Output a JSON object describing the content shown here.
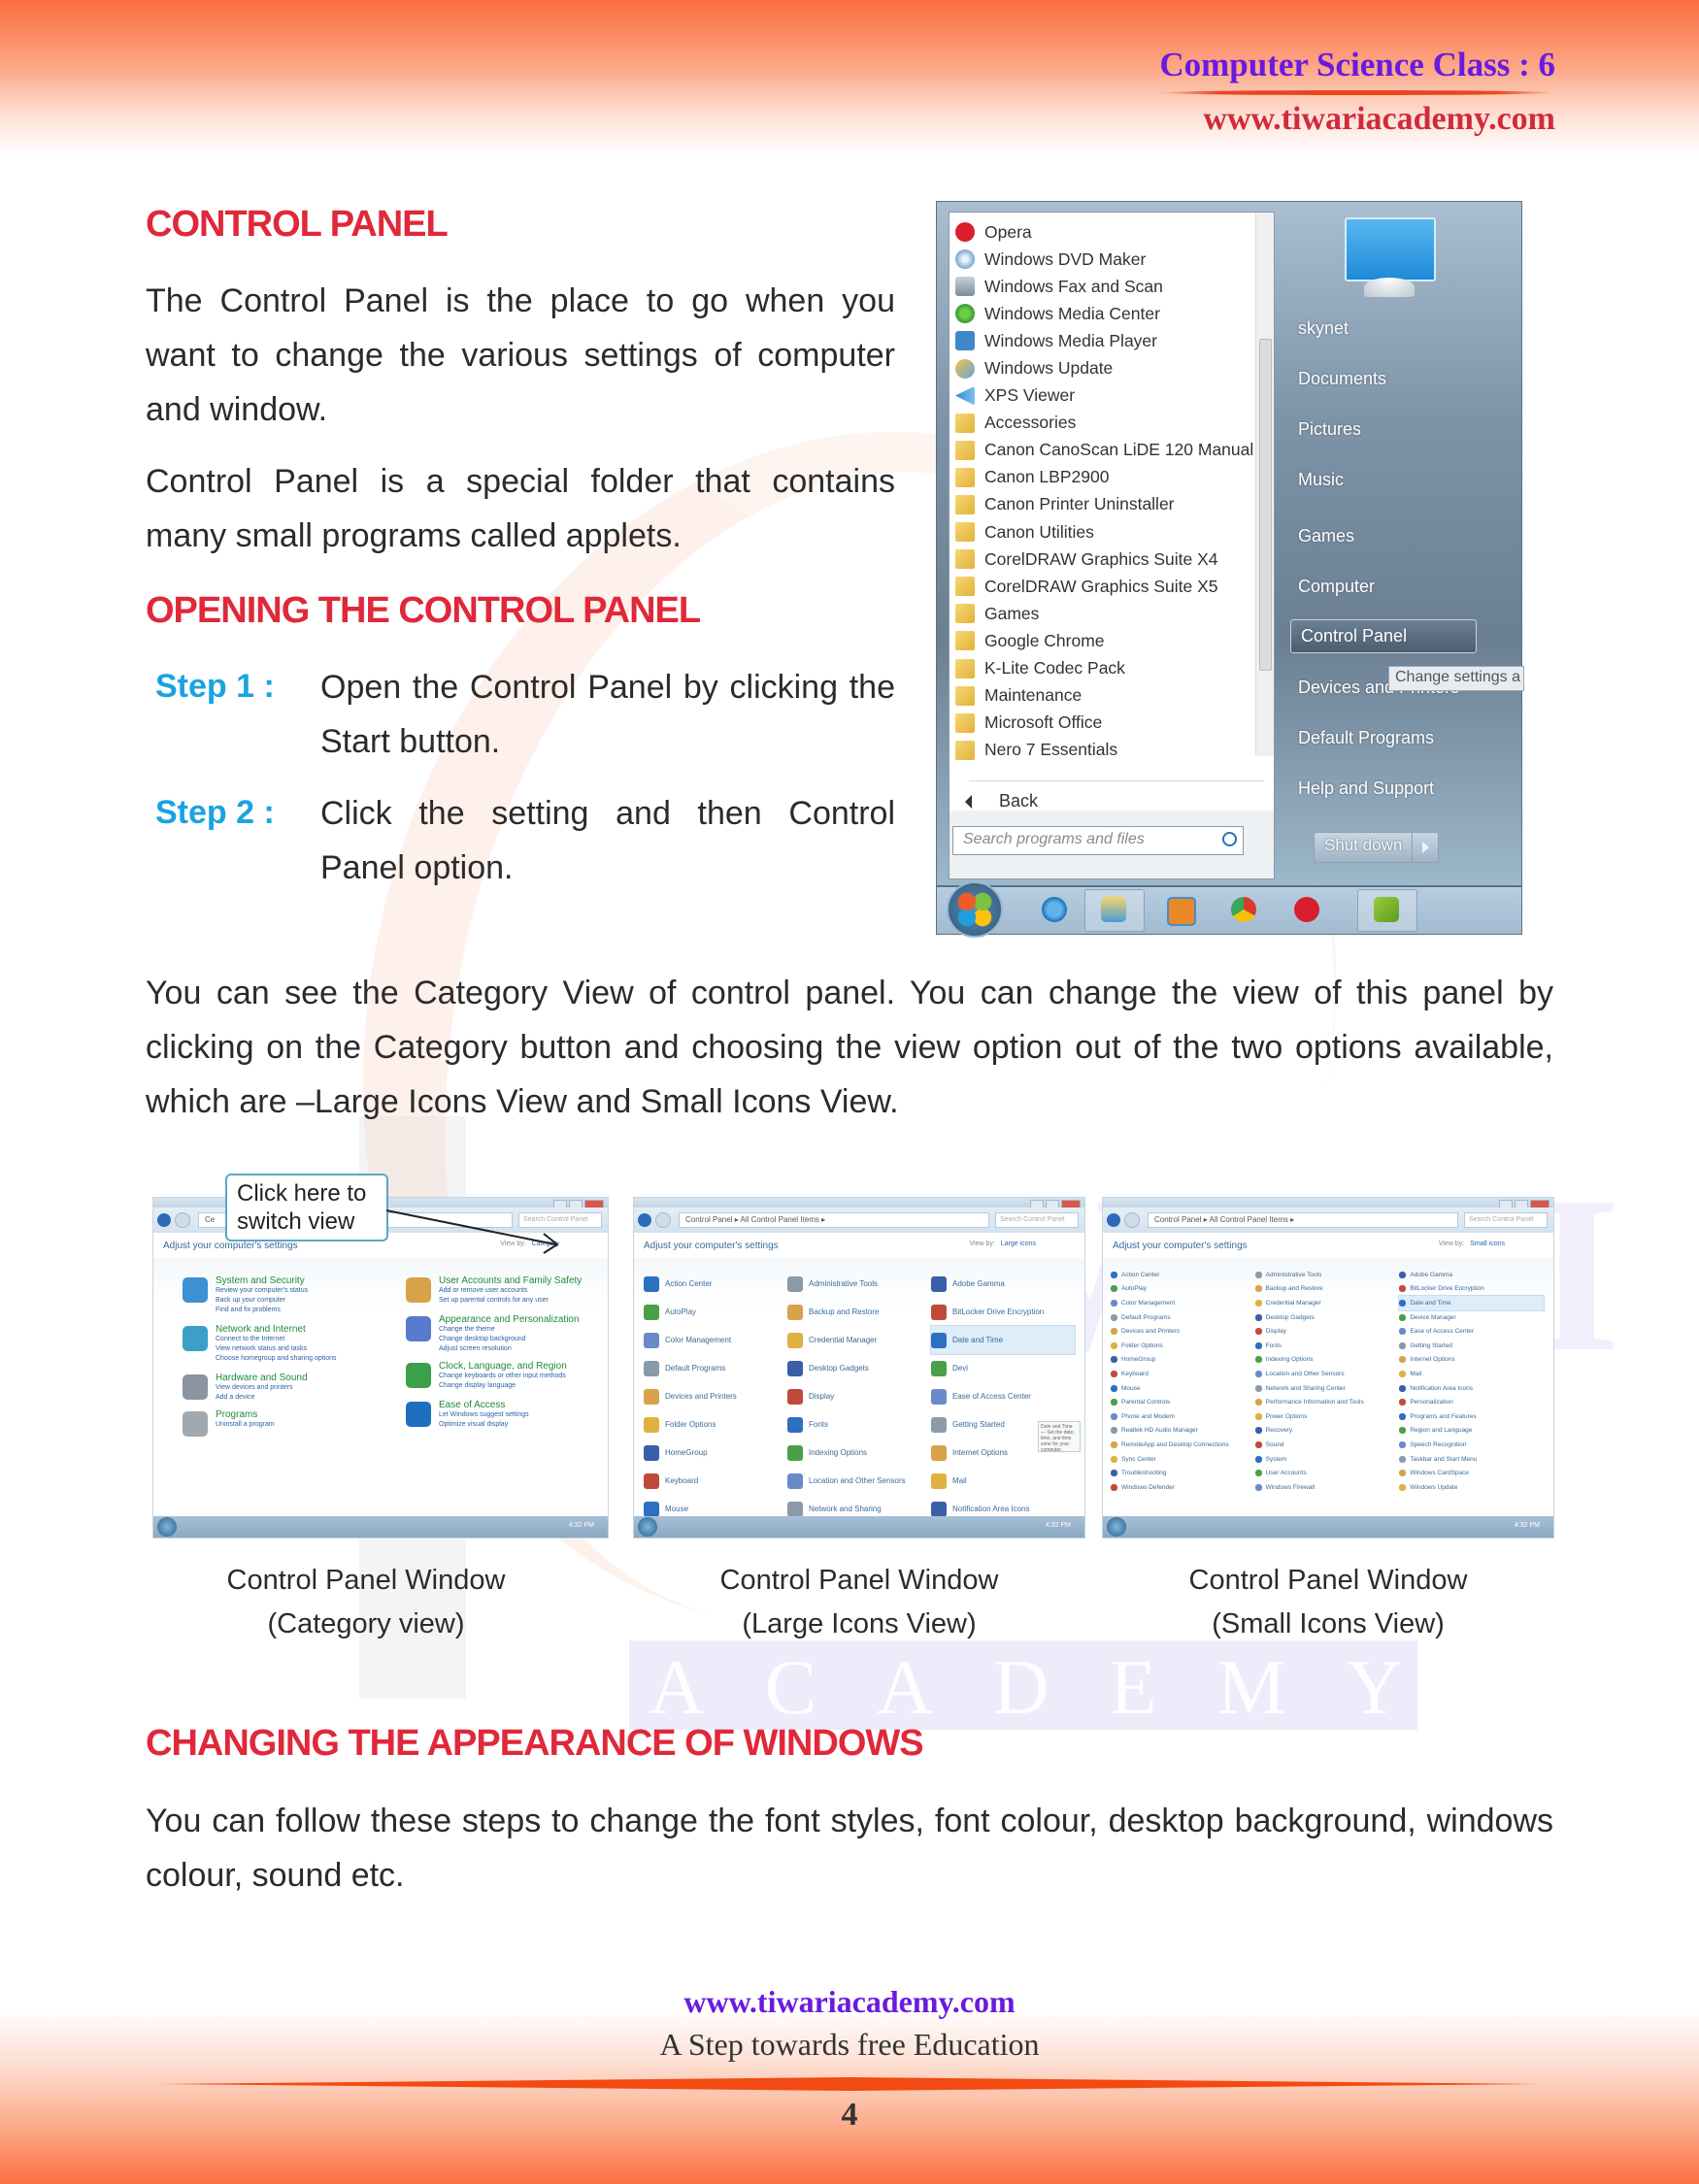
{
  "header": {
    "title": "Computer Science Class : 6",
    "url": "www.tiwariacademy.com"
  },
  "watermark": {
    "word": "TIWARI",
    "academy": "ACADEMY"
  },
  "sections": {
    "control_panel": {
      "heading": "CONTROL PANEL",
      "para1": "The Control Panel is the place to go when you want to change the various settings of computer and window.",
      "para2": "Control Panel is a special folder that contains many small programs called applets."
    },
    "opening": {
      "heading": "OPENING THE CONTROL PANEL",
      "steps": [
        {
          "label": "Step 1 :",
          "text": "Open the Control Panel by clicking the Start button."
        },
        {
          "label": "Step 2 :",
          "text": "Click the setting and then Control Panel option."
        }
      ]
    },
    "views_para": "You can see the Category View of control panel. You can change the view of this panel by clicking on the Category button and choosing the view option out of the two options available, which are –Large Icons View and Small Icons View.",
    "appearance": {
      "heading": "CHANGING THE APPEARANCE OF WINDOWS",
      "para": "You can follow these steps to change the font styles, font colour, desktop background, windows colour, sound etc."
    }
  },
  "start_menu": {
    "programs": [
      {
        "label": "Opera",
        "icon": "opera-icon"
      },
      {
        "label": "Windows DVD Maker",
        "icon": "dvd-maker-icon"
      },
      {
        "label": "Windows Fax and Scan",
        "icon": "fax-icon"
      },
      {
        "label": "Windows Media Center",
        "icon": "media-center-icon"
      },
      {
        "label": "Windows Media Player",
        "icon": "media-player-icon"
      },
      {
        "label": "Windows Update",
        "icon": "windows-update-icon"
      },
      {
        "label": "XPS Viewer",
        "icon": "xps-viewer-icon"
      },
      {
        "label": "Accessories",
        "icon": "folder-icon"
      },
      {
        "label": "Canon CanoScan LiDE 120 Manual",
        "icon": "folder-icon"
      },
      {
        "label": "Canon LBP2900",
        "icon": "folder-icon"
      },
      {
        "label": "Canon Printer Uninstaller",
        "icon": "folder-icon"
      },
      {
        "label": "Canon Utilities",
        "icon": "folder-icon"
      },
      {
        "label": "CorelDRAW Graphics Suite X4",
        "icon": "folder-icon"
      },
      {
        "label": "CorelDRAW Graphics Suite X5",
        "icon": "folder-icon"
      },
      {
        "label": "Games",
        "icon": "folder-icon"
      },
      {
        "label": "Google Chrome",
        "icon": "folder-icon"
      },
      {
        "label": "K-Lite Codec Pack",
        "icon": "folder-icon"
      },
      {
        "label": "Maintenance",
        "icon": "folder-icon"
      },
      {
        "label": "Microsoft Office",
        "icon": "folder-icon"
      },
      {
        "label": "Nero 7 Essentials",
        "icon": "folder-icon"
      }
    ],
    "back_label": "Back",
    "search_placeholder": "Search programs and files",
    "right_links": [
      "skynet",
      "Documents",
      "Pictures",
      "Music",
      "Games",
      "Computer",
      "Control Panel",
      "Devices and Printers",
      "Default Programs",
      "Help and Support"
    ],
    "highlighted": "Control Panel",
    "tooltip": "Change settings a",
    "shutdown_label": "Shut down",
    "taskbar_icons": [
      "internet-explorer-icon",
      "libraries-icon",
      "media-player-icon",
      "chrome-icon",
      "opera-icon",
      "green-app-icon"
    ]
  },
  "category_view": {
    "callout": "Click here to switch view",
    "breadcrumb": "Ce",
    "search_placeholder": "Search Control Panel",
    "subhead": "Adjust your computer's settings",
    "view_by_label": "View by:",
    "view_by_value": "Category",
    "categories": [
      {
        "title": "System and Security",
        "links": [
          "Review your computer's status",
          "Back up your computer",
          "Find and fix problems"
        ]
      },
      {
        "title": "Network and Internet",
        "links": [
          "Connect to the Internet",
          "View network status and tasks",
          "Choose homegroup and sharing options"
        ]
      },
      {
        "title": "Hardware and Sound",
        "links": [
          "View devices and printers",
          "Add a device"
        ]
      },
      {
        "title": "Programs",
        "links": [
          "Uninstall a program"
        ]
      },
      {
        "title": "User Accounts and Family Safety",
        "links": [
          "Add or remove user accounts",
          "Set up parental controls for any user"
        ]
      },
      {
        "title": "Appearance and Personalization",
        "links": [
          "Change the theme",
          "Change desktop background",
          "Adjust screen resolution"
        ]
      },
      {
        "title": "Clock, Language, and Region",
        "links": [
          "Change keyboards or other input methods",
          "Change display language"
        ]
      },
      {
        "title": "Ease of Access",
        "links": [
          "Let Windows suggest settings",
          "Optimize visual display"
        ]
      }
    ],
    "clock": "4:32 PM"
  },
  "large_icons_view": {
    "breadcrumb": "Control Panel ▸ All Control Panel Items ▸",
    "search_placeholder": "Search Control Panel",
    "subhead": "Adjust your computer's settings",
    "view_by_label": "View by:",
    "view_by_value": "Large icons",
    "items": [
      "Action Center",
      "Administrative Tools",
      "Adobe Gamma",
      "AutoPlay",
      "Backup and Restore",
      "BitLocker Drive Encryption",
      "Color Management",
      "Credential Manager",
      "Date and Time",
      "Default Programs",
      "Desktop Gadgets",
      "Devi",
      "Devices and Printers",
      "Display",
      "Ease of Access Center",
      "Folder Options",
      "Fonts",
      "Getting Started",
      "HomeGroup",
      "Indexing Options",
      "Internet Options",
      "Keyboard",
      "Location and Other Sensors",
      "Mail",
      "Mouse",
      "Network and Sharing",
      "Notification Area Icons"
    ],
    "tooltip": "Date and Time — Set the date, time, and time zone for your computer.",
    "clock": "4:32 PM"
  },
  "small_icons_view": {
    "breadcrumb": "Control Panel ▸ All Control Panel Items ▸",
    "search_placeholder": "Search Control Panel",
    "subhead": "Adjust your computer's settings",
    "view_by_label": "View by:",
    "view_by_value": "Small icons",
    "items": [
      "Action Center",
      "Administrative Tools",
      "Adobe Gamma",
      "AutoPlay",
      "Backup and Restore",
      "BitLocker Drive Encryption",
      "Color Management",
      "Credential Manager",
      "Date and Time",
      "Default Programs",
      "Desktop Gadgets",
      "Device Manager",
      "Devices and Printers",
      "Display",
      "Ease of Access Center",
      "Folder Options",
      "Fonts",
      "Getting Started",
      "HomeGroup",
      "Indexing Options",
      "Internet Options",
      "Keyboard",
      "Location and Other Sensors",
      "Mail",
      "Mouse",
      "Network and Sharing Center",
      "Notification Area Icons",
      "Parental Controls",
      "Performance Information and Tools",
      "Personalization",
      "Phone and Modem",
      "Power Options",
      "Programs and Features",
      "Realtek HD Audio Manager",
      "Recovery",
      "Region and Language",
      "RemoteApp and Desktop Connections",
      "Sound",
      "Speech Recognition",
      "Sync Center",
      "System",
      "Taskbar and Start Menu",
      "Troubleshooting",
      "User Accounts",
      "Windows CardSpace",
      "Windows Defender",
      "Windows Firewall",
      "Windows Update"
    ],
    "clock": "4:32 PM"
  },
  "captions": [
    {
      "line1": "Control Panel Window",
      "line2": "(Category view)"
    },
    {
      "line1": "Control Panel Window",
      "line2": "(Large Icons View)"
    },
    {
      "line1": "Control Panel Window",
      "line2": "(Small Icons View)"
    }
  ],
  "footer": {
    "url": "www.tiwariacademy.com",
    "tagline": "A Step towards free Education",
    "page_number": "4"
  },
  "colors": {
    "heading_red": "#e0283a",
    "step_blue": "#1aa3df",
    "header_purple": "#6a1ae0",
    "header_url_red": "#d22a3a",
    "band_orange": "#fb6d3f"
  }
}
